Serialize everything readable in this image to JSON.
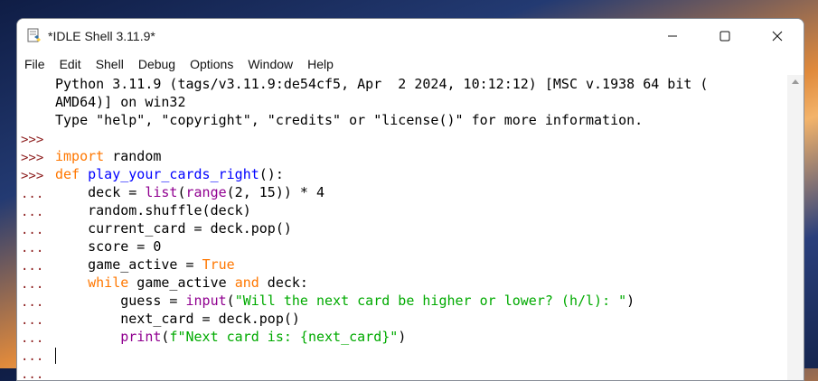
{
  "window": {
    "title": "*IDLE Shell 3.11.9*",
    "controls": {
      "minimize": "—",
      "maximize": "☐",
      "close": "✕"
    }
  },
  "menu": [
    "File",
    "Edit",
    "Shell",
    "Debug",
    "Options",
    "Window",
    "Help"
  ],
  "gutter": [
    "",
    "",
    "",
    ">>>",
    ">>>",
    ">>>",
    "...",
    "...",
    "...",
    "...",
    "...",
    "...",
    "...",
    "...",
    "...",
    "...",
    "..."
  ],
  "colors": {
    "keyword": "#ff7700",
    "builtin": "#900090",
    "def_name": "#0000ff",
    "string": "#00aa00",
    "prompt": "#8b1a1a"
  },
  "shell": {
    "banner1": "Python 3.11.9 (tags/v3.11.9:de54cf5, Apr  2 2024, 10:12:12) [MSC v.1938 64 bit (",
    "banner2": "AMD64)] on win32",
    "banner3": "Type \"help\", \"copyright\", \"credits\" or \"license()\" for more information.",
    "l_import_kw": "import",
    "l_import_rest": " random",
    "l_def_kw": "def",
    "l_def_name": "play_your_cards_right",
    "l_def_rest": "():",
    "l_deck_a": "    deck = ",
    "l_deck_list": "list",
    "l_deck_b": "(",
    "l_deck_range": "range",
    "l_deck_c": "(2, 15)) * 4",
    "l_shuffle": "    random.shuffle(deck)",
    "l_current": "    current_card = deck.pop()",
    "l_score": "    score = 0",
    "l_game_a": "    game_active = ",
    "l_game_true": "True",
    "l_while_indent": "    ",
    "l_while_kw": "while",
    "l_while_mid": " game_active ",
    "l_while_and": "and",
    "l_while_rest": " deck:",
    "l_guess_a": "        guess = ",
    "l_guess_input": "input",
    "l_guess_b": "(",
    "l_guess_str": "\"Will the next card be higher or lower? (h/l): \"",
    "l_guess_c": ")",
    "l_next": "        next_card = deck.pop()",
    "l_print_indent": "        ",
    "l_print_fn": "print",
    "l_print_b": "(",
    "l_print_str": "f\"Next card is: {next_card}\"",
    "l_print_c": ")"
  }
}
